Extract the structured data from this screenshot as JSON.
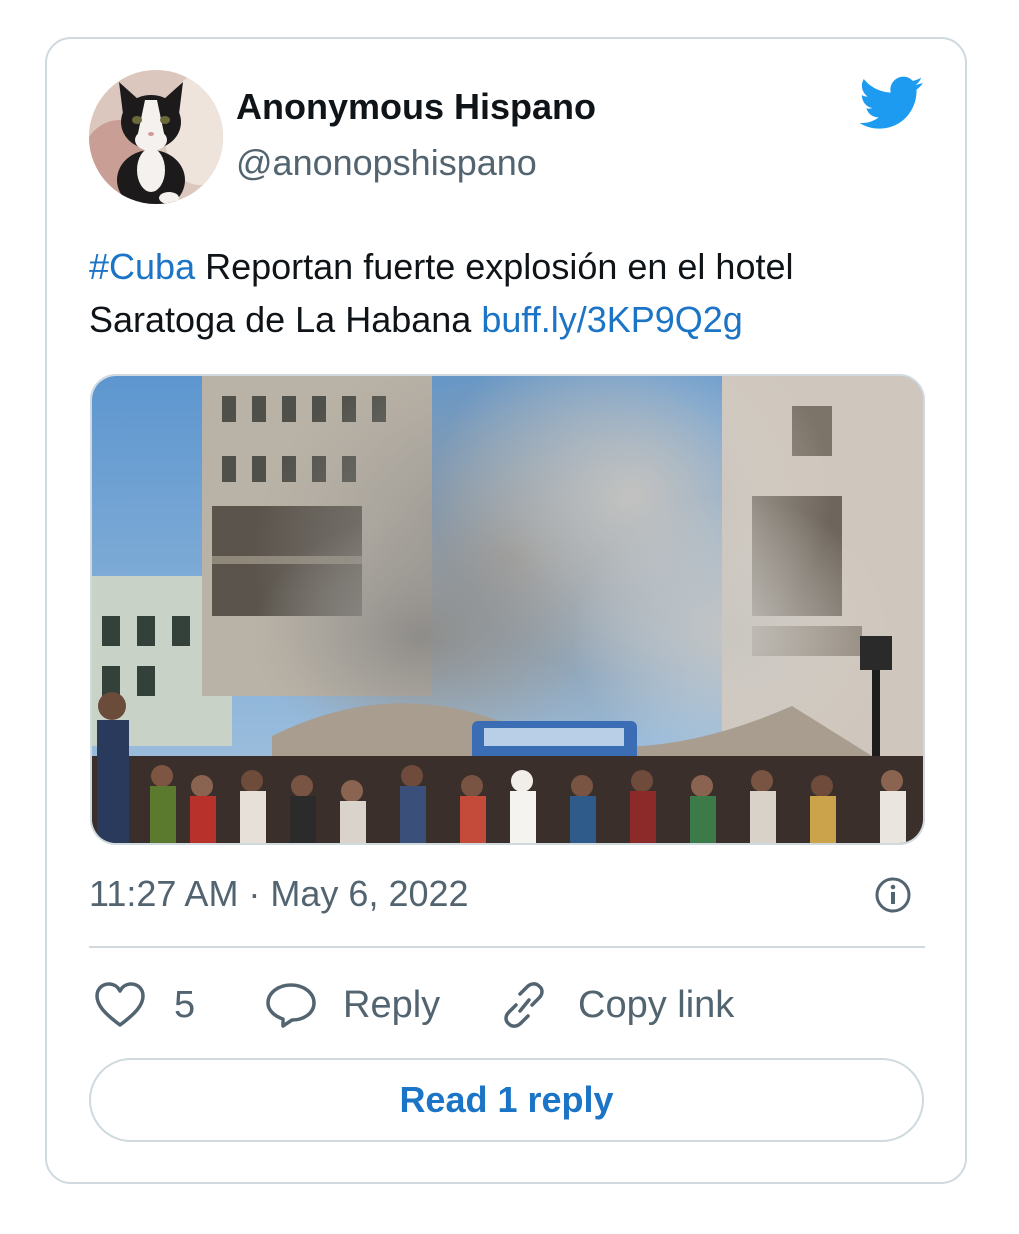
{
  "tweet": {
    "author_name": "Anonymous Hispano",
    "author_handle": "@anonopshispano",
    "hashtag": "#Cuba",
    "text_line1": " Reportan fuerte explosión en el hotel",
    "text_line2": "Saratoga de La Habana ",
    "link_text": "buff.ly/3KP9Q2g",
    "timestamp": "11:27 AM · May 6, 2022",
    "avatar_icon": "cat-avatar",
    "platform_icon": "twitter-bird-icon"
  },
  "actions": {
    "like_count": "5",
    "reply_label": "Reply",
    "copy_link_label": "Copy link"
  },
  "read_replies_label": "Read 1 reply",
  "colors": {
    "accent": "#1b74c5",
    "twitter_blue": "#1d9bf0",
    "secondary_text": "#536471",
    "border": "#cfd9de"
  }
}
